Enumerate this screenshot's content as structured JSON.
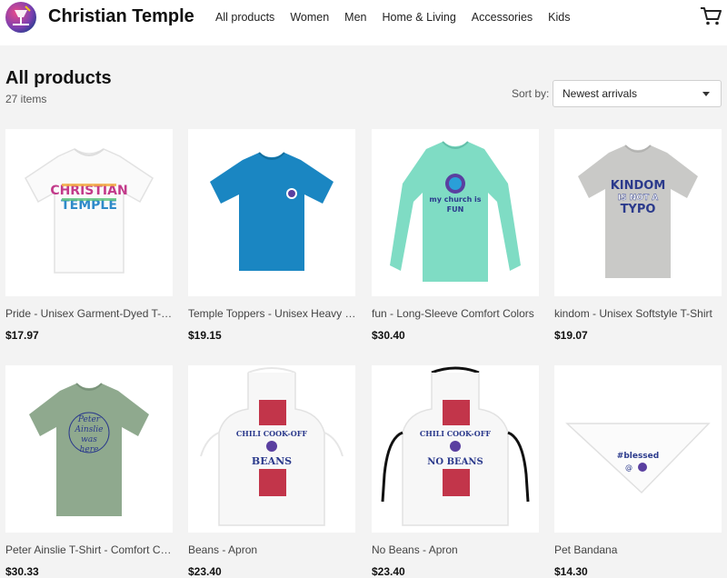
{
  "brand": {
    "name": "Christian Temple"
  },
  "nav": [
    "All products",
    "Women",
    "Men",
    "Home & Living",
    "Accessories",
    "Kids"
  ],
  "page": {
    "title": "All products",
    "count": "27 items"
  },
  "sort": {
    "label": "Sort by:",
    "value": "Newest arrivals"
  },
  "products": [
    {
      "name": "Pride - Unisex Garment-Dyed T-shirt",
      "price": "$17.97",
      "graphic_text": "CHRISTIAN TEMPLE"
    },
    {
      "name": "Temple Toppers - Unisex Heavy Cotton Tee",
      "price": "$19.15"
    },
    {
      "name": "fun - Long-Sleeve Comfort Colors",
      "price": "$30.40",
      "graphic_text_1": "my church is",
      "graphic_text_2": "FUN"
    },
    {
      "name": "kindom - Unisex Softstyle T-Shirt",
      "price": "$19.07",
      "graphic_text_1": "KINDOM",
      "graphic_text_2": "IS NOT A",
      "graphic_text_3": "TYPO"
    },
    {
      "name": "Peter Ainslie T-Shirt - Comfort Colors",
      "price": "$30.33",
      "graphic_text_1": "Peter",
      "graphic_text_2": "Ainslie",
      "graphic_text_3": "was",
      "graphic_text_4": "here"
    },
    {
      "name": "Beans - Apron",
      "price": "$23.40",
      "graphic_text_1": "CHILI COOK-OFF",
      "graphic_text_2": "BEANS"
    },
    {
      "name": "No Beans - Apron",
      "price": "$23.40",
      "graphic_text_1": "CHILI COOK-OFF",
      "graphic_text_2": "NO BEANS"
    },
    {
      "name": "Pet Bandana",
      "price": "$14.30",
      "graphic_text": "#blessed"
    }
  ],
  "colors": {
    "accent": "#2b3a8c",
    "tee_blue": "#1a86c2",
    "tee_mint": "#7fdcc4",
    "tee_gray": "#c9c9c7",
    "tee_sage": "#8fa98e",
    "pattern_red": "#c2354a"
  }
}
